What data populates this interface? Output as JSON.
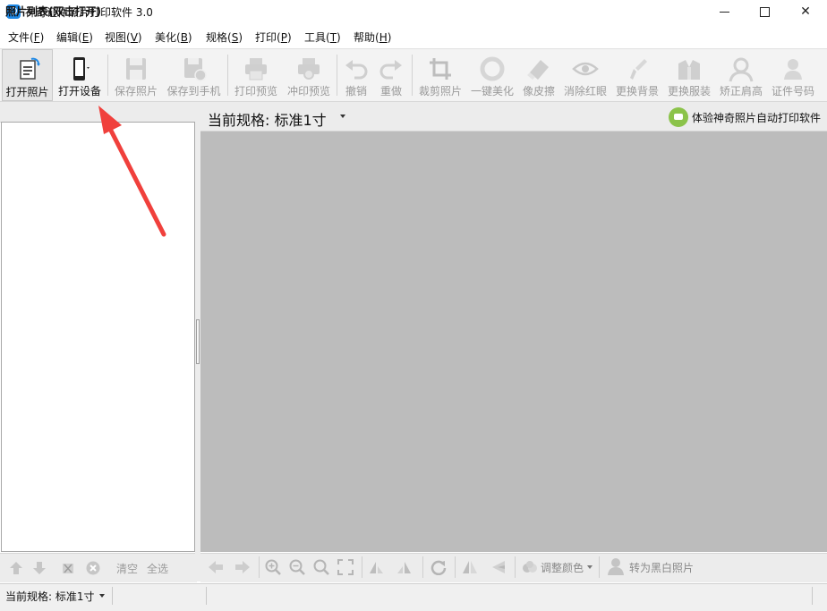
{
  "window": {
    "title": "神奇证件照片打印软件 3.0",
    "controls": {
      "minimize": "minimize-icon",
      "maximize": "maximize-icon",
      "close": "✕"
    }
  },
  "menu": [
    {
      "label": "文件(",
      "key": "F",
      "tail": ")"
    },
    {
      "label": "编辑(",
      "key": "E",
      "tail": ")"
    },
    {
      "label": "视图(",
      "key": "V",
      "tail": ")"
    },
    {
      "label": "美化(",
      "key": "B",
      "tail": ")"
    },
    {
      "label": "规格(",
      "key": "S",
      "tail": ")"
    },
    {
      "label": "打印(",
      "key": "P",
      "tail": ")"
    },
    {
      "label": "工具(",
      "key": "T",
      "tail": ")"
    },
    {
      "label": "帮助(",
      "key": "H",
      "tail": ")"
    }
  ],
  "toolbar": [
    {
      "label": "打开照片",
      "icon": "open-photo-icon",
      "enabled": true
    },
    {
      "label": "打开设备",
      "icon": "phone-device-icon",
      "enabled": true
    },
    {
      "label": "保存照片",
      "icon": "save-icon",
      "enabled": false
    },
    {
      "label": "保存到手机",
      "icon": "save-to-phone-icon",
      "enabled": false
    },
    {
      "label": "打印预览",
      "icon": "printer-icon",
      "enabled": false
    },
    {
      "label": "冲印预览",
      "icon": "print-preview-icon",
      "enabled": false
    },
    {
      "label": "撤销",
      "icon": "undo-icon",
      "enabled": false
    },
    {
      "label": "重做",
      "icon": "redo-icon",
      "enabled": false
    },
    {
      "label": "裁剪照片",
      "icon": "crop-icon",
      "enabled": false
    },
    {
      "label": "一键美化",
      "icon": "beautify-icon",
      "enabled": false
    },
    {
      "label": "像皮擦",
      "icon": "eraser-icon",
      "enabled": false
    },
    {
      "label": "消除红眼",
      "icon": "red-eye-icon",
      "enabled": false
    },
    {
      "label": "更换背景",
      "icon": "background-icon",
      "enabled": false
    },
    {
      "label": "更换服装",
      "icon": "clothes-icon",
      "enabled": false
    },
    {
      "label": "矫正肩高",
      "icon": "shoulder-icon",
      "enabled": false
    },
    {
      "label": "证件号码",
      "icon": "id-number-icon",
      "enabled": false
    }
  ],
  "left_panel": {
    "title": "照片列表(双击打开)",
    "tools": {
      "clear": "清空",
      "select_all": "全选"
    }
  },
  "main": {
    "spec_label": "当前规格:",
    "spec_value": "标准1寸",
    "auto_print_link": "体验神奇照片自动打印软件",
    "tools": {
      "adjust_color": "调整颜色",
      "to_bw": "转为黑白照片"
    }
  },
  "status": {
    "spec_label": "当前规格:",
    "spec_value": "标准1寸"
  },
  "colors": {
    "accent_arrow": "#f0403c",
    "canvas_bg": "#bcbcbc",
    "app_icon": "#1e88e5",
    "auto_icon": "#8bc34a"
  }
}
